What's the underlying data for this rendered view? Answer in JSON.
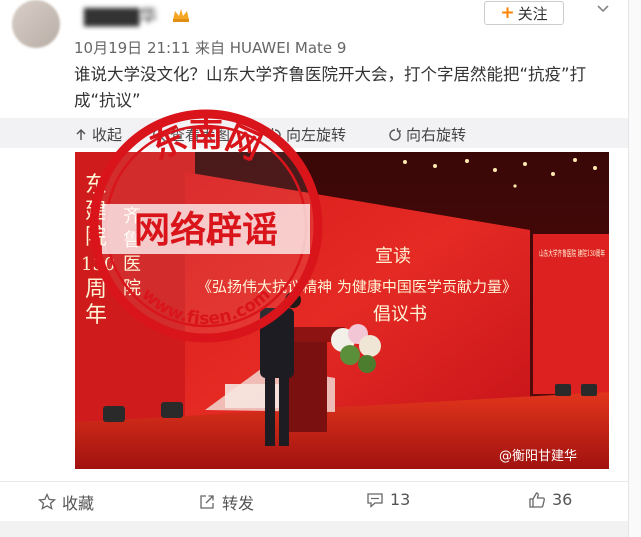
{
  "post": {
    "username": "▇▇▇▇华",
    "follow_label": "关注",
    "meta": "10月19日 21:11 来自 HUAWEI Mate 9",
    "text": "谁说大学没文化？山东大学齐鲁医院开大会，打个字居然能把“抗疫”打成“抗议”"
  },
  "image_toolbar": {
    "collapse": "收起",
    "view_large": "查看大图",
    "rotate_left": "向左旋转",
    "rotate_right": "向右旋转"
  },
  "photo": {
    "backdrop_left": [
      "东",
      "建",
      "院",
      "130",
      "周",
      "年",
      "齐",
      "鲁",
      "医",
      "院"
    ],
    "banner_top": "宣读",
    "banner_main": "《弘扬伟大抗议精神 为健康中国医学贡献力量》",
    "banner_bottom": "倡议书",
    "side_panel": "山东大学齐鲁医院 建院130周年",
    "watermark": "@衡阳甘建华"
  },
  "stamp": {
    "top_text": "东南网",
    "center_text": "网络辟谣",
    "bottom_text": "www.fjsen.com"
  },
  "actions": {
    "favorite": "收藏",
    "repost": "转发",
    "comments": "13",
    "likes": "36"
  },
  "colors": {
    "accent": "#ff8200",
    "stamp_red": "#d9151b"
  }
}
